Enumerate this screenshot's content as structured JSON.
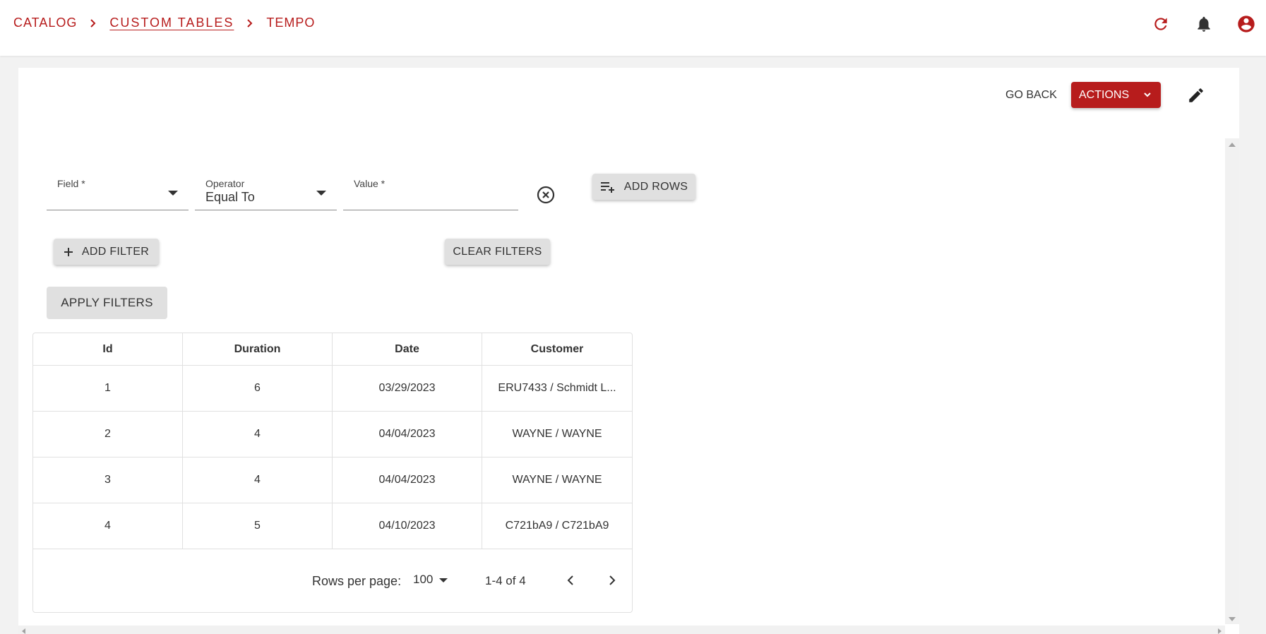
{
  "breadcrumb": {
    "items": [
      "CATALOG",
      "CUSTOM TABLES",
      "TEMPO"
    ]
  },
  "topbar": {
    "icons": [
      "refresh-icon",
      "bell-icon",
      "account-circle-icon"
    ],
    "accent_color": "#b71c1c"
  },
  "header_actions": {
    "go_back_label": "GO BACK",
    "actions_label": "ACTIONS",
    "edit_icon": "pencil-icon"
  },
  "filter": {
    "field_label": "Field *",
    "field_value": "",
    "operator_label": "Operator",
    "operator_value": "Equal To",
    "value_label": "Value *",
    "value_value": "",
    "clear_icon": "circle-x-icon"
  },
  "buttons": {
    "add_rows": "ADD ROWS",
    "add_filter": "ADD FILTER",
    "clear_filters": "CLEAR FILTERS",
    "apply_filters": "APPLY FILTERS"
  },
  "table": {
    "columns": [
      "Id",
      "Duration",
      "Date",
      "Customer"
    ],
    "rows": [
      [
        "1",
        "6",
        "03/29/2023",
        "ERU7433 / Schmidt L..."
      ],
      [
        "2",
        "4",
        "04/04/2023",
        "WAYNE / WAYNE"
      ],
      [
        "3",
        "4",
        "04/04/2023",
        "WAYNE / WAYNE"
      ],
      [
        "4",
        "5",
        "04/10/2023",
        "C721bA9 / C721bA9"
      ]
    ]
  },
  "pagination": {
    "rows_per_page_label": "Rows per page:",
    "rows_per_page_value": "100",
    "range": "1-4 of 4"
  }
}
